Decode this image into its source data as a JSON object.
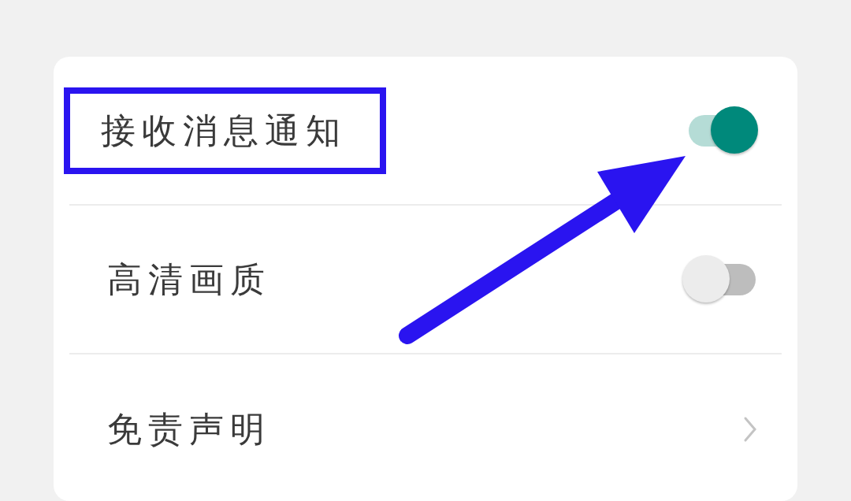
{
  "settings": [
    {
      "kind": "toggle",
      "label": "接收消息通知",
      "on": true,
      "highlighted": true
    },
    {
      "kind": "toggle",
      "label": "高清画质",
      "on": false,
      "highlighted": false
    },
    {
      "kind": "link",
      "label": "免责声明",
      "highlighted": false
    }
  ],
  "annotation": {
    "kind": "arrow"
  }
}
